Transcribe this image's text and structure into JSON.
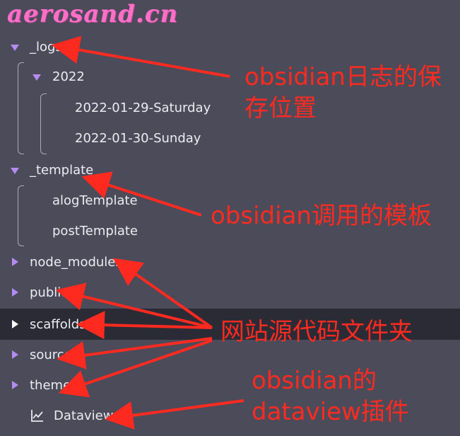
{
  "watermark": "aerosand.cn",
  "tree": {
    "logs": "_logs",
    "year": "2022",
    "note1": "2022-01-29-Saturday",
    "note2": "2022-01-30-Sunday",
    "template": "_template",
    "alog": "alogTemplate",
    "post": "postTemplate",
    "node_modules": "node_modules",
    "public": "public",
    "scaffolds": "scaffolds",
    "source": "source",
    "themes": "themes",
    "dataview": "Dataview"
  },
  "annotations": {
    "logs_line1": "obsidian日志的保",
    "logs_line2": "存位置",
    "template": "obsidian调用的模板",
    "site_source": "网站源代码文件夹",
    "dataview_line1": "obsidian的",
    "dataview_line2": "dataview插件"
  },
  "colors": {
    "background": "#4b4b5a",
    "selected_row": "#2b2b36",
    "chevron": "#b48cf0",
    "annotation_red": "#ff2a1f",
    "watermark_pink": "#ff6fc8"
  },
  "icons": {
    "collapse": "triangle-down-icon",
    "expand": "triangle-right-icon",
    "plugin": "chart-line-icon"
  }
}
